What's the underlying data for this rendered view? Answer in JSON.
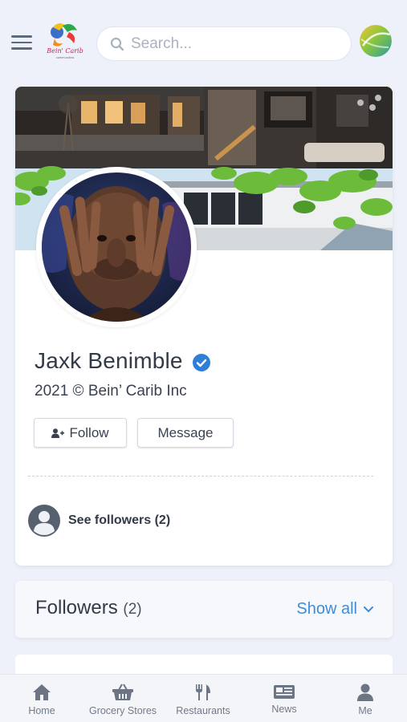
{
  "header": {
    "search_placeholder": "Search...",
    "logo_alt": "Bein' Carib"
  },
  "profile": {
    "name": "Jaxk Benimble",
    "subtitle": "2021 © Bein’ Carib Inc",
    "follow_label": "Follow",
    "message_label": "Message",
    "see_followers_label": "See followers (2)"
  },
  "followers_section": {
    "title": "Followers",
    "count": "(2)",
    "show_all_label": "Show all"
  },
  "bottom_nav": {
    "items": [
      {
        "label": "Home",
        "icon": "home-icon"
      },
      {
        "label": "Grocery Stores",
        "icon": "basket-icon"
      },
      {
        "label": "Restaurants",
        "icon": "fork-knife-icon"
      },
      {
        "label": "News",
        "icon": "newspaper-icon"
      },
      {
        "label": "Me",
        "icon": "person-icon"
      }
    ]
  },
  "colors": {
    "accent": "#3c8dd6",
    "background": "#eef1f9",
    "verified": "#2f7fd9"
  }
}
